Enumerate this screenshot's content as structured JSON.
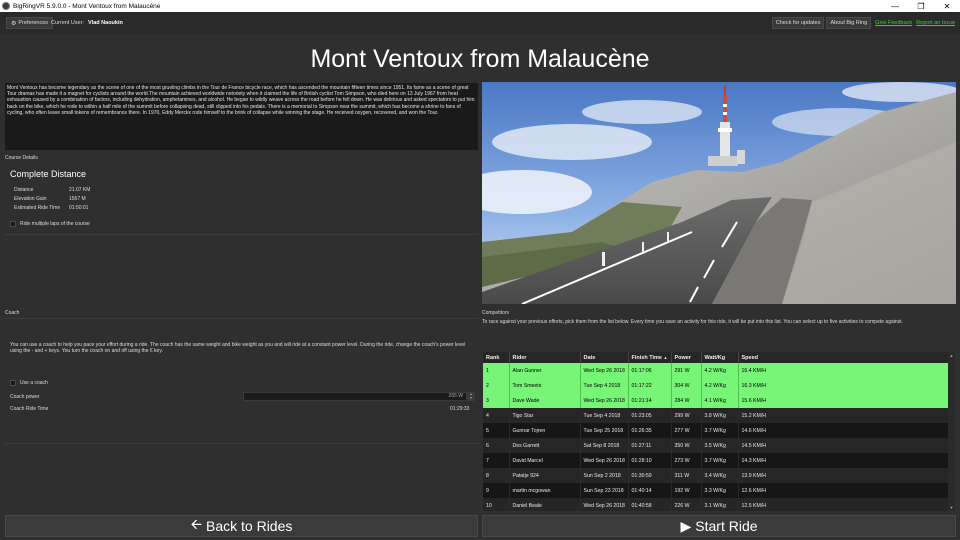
{
  "window": {
    "title": "BigRingVR 5.9.0.0 - Mont Ventoux from Malaucène"
  },
  "toolbar": {
    "preferences_label": "Preferences",
    "current_user_label": "Current User:",
    "current_user_name": "Vlad Naoukin",
    "check_updates_label": "Check for updates",
    "about_label": "About Big Ring",
    "give_feedback_label": "Give Feedback",
    "report_issue_label": "Report an Issue"
  },
  "course": {
    "title": "Mont Ventoux from Malaucène",
    "description": "Mont Ventoux has become legendary as the scene of one of the most grueling climbs in the Tour de France bicycle race, which has ascended the mountain fifteen times since 1951. Its fame as a scene of great Tour dramas has made it a magnet for cyclists around the world.The mountain achieved worldwide notoriety when it claimed the life of British cyclist Tom Simpson, who died here on 13 July 1967 from heat exhaustion caused by a combination of factors, including dehydration, amphetamines, and alcohol. He began to wildly weave across the road before he fell down. He was delirious and asked spectators to put him back on the bike, which he rode to within a half mile of the summit before collapsing dead, still clipped into his pedals. There is a memorial to Simpson near the summit, which has become a shrine to fans of cycling, who often leave small tokens of remembrance there. In 1970, Eddy Merckx rode himself to the brink of collapse while winning the stage. He received oxygen, recovered, and won the Tour.",
    "details_label": "Course Details",
    "complete_distance_label": "Complete Distance",
    "distance_label": "Distance",
    "distance_value": "21.07 KM",
    "elevation_label": "Elevation Gain",
    "elevation_value": "1567 M",
    "ride_time_label": "Estimated Ride Time",
    "ride_time_value": "01:50:01",
    "multiple_laps_label": "Ride multiple laps of the course"
  },
  "coach": {
    "section_label": "Coach",
    "description": "You can use a coach to help you pace your effort during a ride. The coach has the same weight and bike weight as you and will ride at a constant power level. During the ride, change the coach's power level using the - and + keys. You turn the coach on and off using the € key.",
    "use_coach_label": "Use a coach",
    "power_label": "Coach power",
    "power_value": "265 W",
    "ride_time_label": "Coach Ride Time",
    "ride_time_value": "01:29:33"
  },
  "competitors": {
    "section_label": "Competitors",
    "description": "To race against your previous efforts, pick them from the list below. Every time you save an activity for this ride, it will be put into this list. You can select up to five activities to compete against.",
    "columns": [
      "Rank",
      "Rider",
      "Date",
      "Finish Time",
      "Power",
      "Watt/Kg",
      "Speed"
    ],
    "rows": [
      {
        "rank": "1",
        "rider": "Alan Gunner",
        "date": "Wed Sep 26 2018",
        "time": "01:17:06",
        "power": "291 W",
        "wkg": "4.2 W/Kg",
        "speed": "16.4 KM/H",
        "selected": true
      },
      {
        "rank": "2",
        "rider": "Tom Smeets",
        "date": "Tue Sep 4 2018",
        "time": "01:17:22",
        "power": "304 W",
        "wkg": "4.2 W/Kg",
        "speed": "16.3 KM/H",
        "selected": true
      },
      {
        "rank": "3",
        "rider": "Dave Wade",
        "date": "Wed Sep 26 2018",
        "time": "01:21:14",
        "power": "284 W",
        "wkg": "4.1 W/Kg",
        "speed": "15.6 KM/H",
        "selected": true
      },
      {
        "rank": "4",
        "rider": "Tigo Star",
        "date": "Tue Sep 4 2018",
        "time": "01:23:05",
        "power": "299 W",
        "wkg": "3.8 W/Kg",
        "speed": "15.2 KM/H",
        "selected": false
      },
      {
        "rank": "5",
        "rider": "Gunnar Tojren",
        "date": "Tue Sep 25 2018",
        "time": "01:26:35",
        "power": "277 W",
        "wkg": "3.7 W/Kg",
        "speed": "14.6 KM/H",
        "selected": false
      },
      {
        "rank": "6",
        "rider": "Des Garrett",
        "date": "Sat Sep 8 2018",
        "time": "01:27:11",
        "power": "350 W",
        "wkg": "3.5 W/Kg",
        "speed": "14.5 KM/H",
        "selected": false
      },
      {
        "rank": "7",
        "rider": "David Marcel",
        "date": "Wed Sep 26 2018",
        "time": "01:28:10",
        "power": "273 W",
        "wkg": "3.7 W/Kg",
        "speed": "14.3 KM/H",
        "selected": false
      },
      {
        "rank": "8",
        "rider": "Patatje 924",
        "date": "Sun Sep 2 2018",
        "time": "01:30:59",
        "power": "311 W",
        "wkg": "3.4 W/Kg",
        "speed": "13.9 KM/H",
        "selected": false
      },
      {
        "rank": "9",
        "rider": "martin mcgowan",
        "date": "Sun Sep 23 2018",
        "time": "01:40:14",
        "power": "192 W",
        "wkg": "3.3 W/Kg",
        "speed": "12.6 KM/H",
        "selected": false
      },
      {
        "rank": "10",
        "rider": "Daniel Beale",
        "date": "Wed Sep 26 2018",
        "time": "01:40:58",
        "power": "226 W",
        "wkg": "3.1 W/Kg",
        "speed": "12.5 KM/H",
        "selected": false
      }
    ]
  },
  "buttons": {
    "back_label": "Back to Rides",
    "start_label": "Start Ride"
  },
  "colors": {
    "selected_row": "#76f576",
    "link": "#38d038",
    "background": "#2f2f2f"
  }
}
